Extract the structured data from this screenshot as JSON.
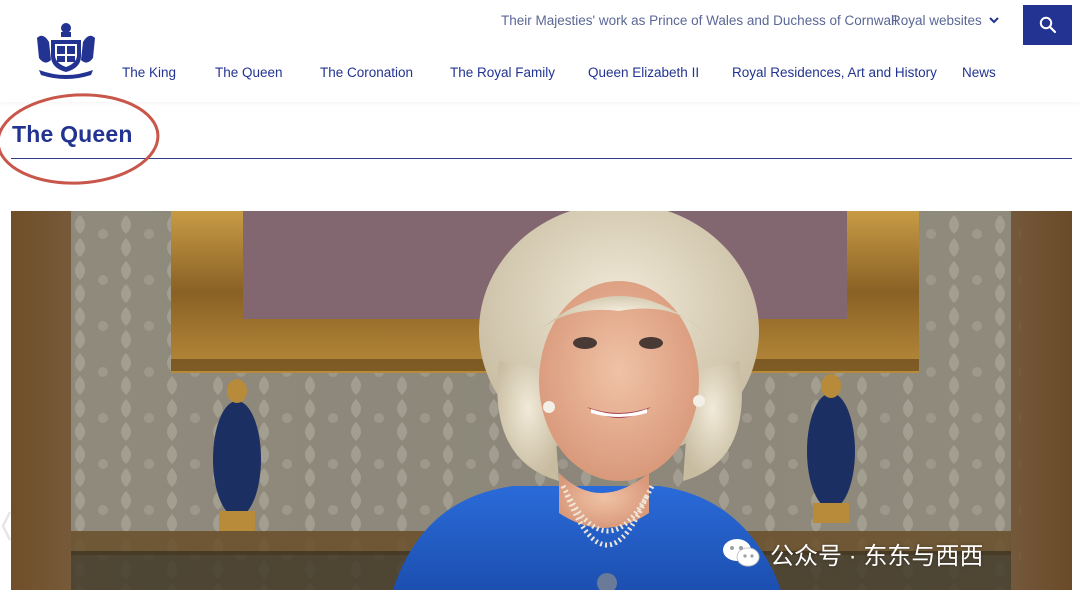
{
  "header": {
    "util_links": {
      "majesties": "Their Majesties' work as Prince of Wales and Duchess of Cornwall",
      "royal_websites": "Royal websites"
    },
    "nav": [
      "The King",
      "The Queen",
      "The Coronation",
      "The Royal Family",
      "Queen Elizabeth II",
      "Royal Residences, Art and History",
      "News"
    ]
  },
  "page": {
    "title": "The Queen"
  },
  "watermark": {
    "text": "公众号 · 东东与西西"
  },
  "colors": {
    "brand_navy": "#223391",
    "link_muted": "#5a6796",
    "annotation_red": "#c9564a"
  },
  "icons": {
    "crest": "royal-coat-of-arms-icon",
    "search": "search-icon",
    "dropdown": "chevron-down-icon",
    "wechat": "wechat-icon"
  }
}
